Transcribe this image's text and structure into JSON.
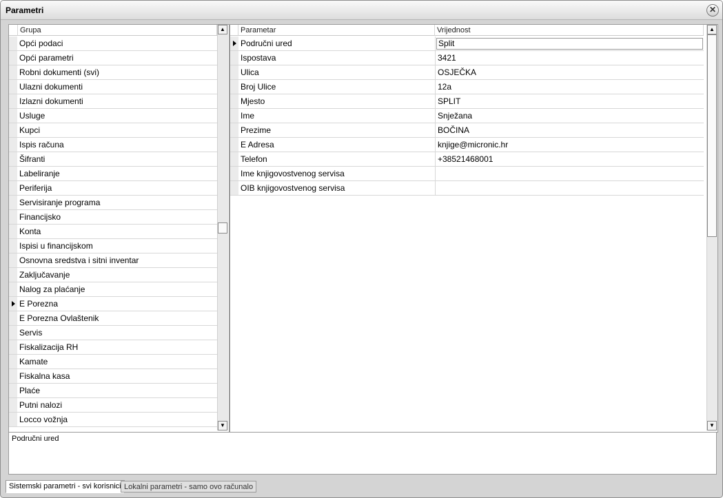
{
  "window": {
    "title": "Parametri",
    "close_glyph": "✕"
  },
  "groups": {
    "header": "Grupa",
    "items": [
      "Opći podaci",
      "Opći parametri",
      "Robni dokumenti (svi)",
      "Ulazni dokumenti",
      "Izlazni dokumenti",
      "Usluge",
      "Kupci",
      "Ispis računa",
      "Šifranti",
      "Labeliranje",
      "Periferija",
      "Servisiranje programa",
      "Financijsko",
      "Konta",
      "Ispisi u financijskom",
      "Osnovna sredstva i sitni inventar",
      "Zaključavanje",
      "Nalog za plaćanje",
      "E Porezna",
      "E Porezna Ovlaštenik",
      "Servis",
      "Fiskalizacija RH",
      "Kamate",
      "Fiskalna kasa",
      "Plaće",
      "Putni nalozi",
      "Locco vožnja"
    ],
    "selected_index": 18
  },
  "params": {
    "header_param": "Parametar",
    "header_value": "Vrijednost",
    "rows": [
      {
        "name": "Područni ured",
        "value": "Split"
      },
      {
        "name": "Ispostava",
        "value": "3421"
      },
      {
        "name": "Ulica",
        "value": "OSJEČKA"
      },
      {
        "name": "Broj Ulice",
        "value": "12a"
      },
      {
        "name": "Mjesto",
        "value": "SPLIT"
      },
      {
        "name": "Ime",
        "value": "Snježana"
      },
      {
        "name": "Prezime",
        "value": "BOČINA"
      },
      {
        "name": "E Adresa",
        "value": "knjige@micronic.hr"
      },
      {
        "name": "Telefon",
        "value": "+38521468001"
      },
      {
        "name": "Ime knjigovostvenog servisa",
        "value": ""
      },
      {
        "name": "OIB knjigovostvenog servisa",
        "value": ""
      }
    ],
    "selected_index": 0
  },
  "description": {
    "text": "Područni ured"
  },
  "tabs": [
    {
      "label": "Sistemski parametri - svi korisnici",
      "active": true
    },
    {
      "label": "Lokalni parametri - samo ovo računalo",
      "active": false
    }
  ],
  "icons": {
    "close": "close-icon",
    "scroll_up": "chevron-up-icon",
    "scroll_down": "chevron-down-icon",
    "row_pointer": "row-pointer-icon"
  }
}
